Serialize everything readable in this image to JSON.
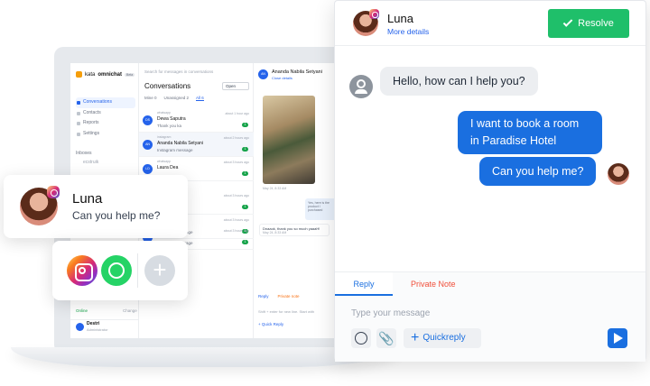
{
  "laptop_app": {
    "brand": "kata",
    "brand_bold": "omnichat",
    "beta": "Beta",
    "nav": [
      "Conversations",
      "Contacts",
      "Reports",
      "Settings"
    ],
    "inboxes_label": "Inboxes",
    "inbox_item": "ecstruik",
    "online": "Online",
    "change": "Change",
    "agent_name": "Destri",
    "agent_role": "Administrator",
    "agent_initial": "D",
    "search_placeholder": "Search for messages in conversations",
    "conv_title": "Conversations",
    "open_select": "Open",
    "tabs": [
      "Mine 0",
      "Unassigned 2",
      "All 6"
    ],
    "rows": [
      {
        "initials": "DS",
        "channel": "whatsapp",
        "name": "Dewa Saputra",
        "msg": "Thank you ka",
        "time": "about 1 hour ago",
        "badge": "1"
      },
      {
        "initials": "AN",
        "channel": "instagram",
        "name": "Ananda Nabila Setyani",
        "msg": "Instagram message",
        "time": "about 2 hours ago",
        "badge": "1"
      },
      {
        "initials": "LD",
        "channel": "whatsapp",
        "name": "Laura Dea",
        "msg": "",
        "time": "about 3 hours ago",
        "badge": "1"
      },
      {
        "initials": "",
        "channel": "",
        "name": "",
        "msg": "...",
        "time": "about 3 hours ago",
        "badge": "1"
      },
      {
        "initials": "",
        "channel": "",
        "name": "",
        "msg": "Instagram message",
        "time": "about 3 hours ago",
        "badge": "1"
      },
      {
        "initials": "SS",
        "channel": "instagram",
        "name": "",
        "msg": "Instagram message",
        "time": "about 3 hours ago",
        "badge": "1"
      }
    ],
    "chat_initials": "AN",
    "chat_name": "Ananda Nabila Setyani",
    "chat_close": "Close details",
    "photo_time": "May 24, 8:33 AM",
    "bubble_out": "Yes, here is the product I purchased",
    "bubble_in": "Dnaaok, thank you so much yaaaH!",
    "bubble_in_time": "May 24, 8:33 AM",
    "reply_tab": "Reply",
    "private_tab": "Private note",
    "reply_placeholder": "Shift + enter for new line. Start with",
    "quick_reply": "+ Quick Reply"
  },
  "luna_card": {
    "name": "Luna",
    "message": "Can you help me?"
  },
  "channels": {
    "add": "+",
    "icons": [
      "instagram-icon",
      "whatsapp-icon",
      "add-icon"
    ]
  },
  "panel": {
    "name": "Luna",
    "more_details": "More details",
    "resolve": "Resolve",
    "messages": {
      "incoming": "Hello, how can I help you?",
      "outgoing_1": "I want to book a room in Paradise Hotel",
      "outgoing_2": "Can you help me?"
    },
    "tab_reply": "Reply",
    "tab_private": "Private Note",
    "placeholder": "Type your message",
    "quickreply": "Quickreply",
    "colors": {
      "primary": "#1a6fe0",
      "resolve": "#1fbf6a",
      "private_note": "#f04f3a"
    }
  }
}
